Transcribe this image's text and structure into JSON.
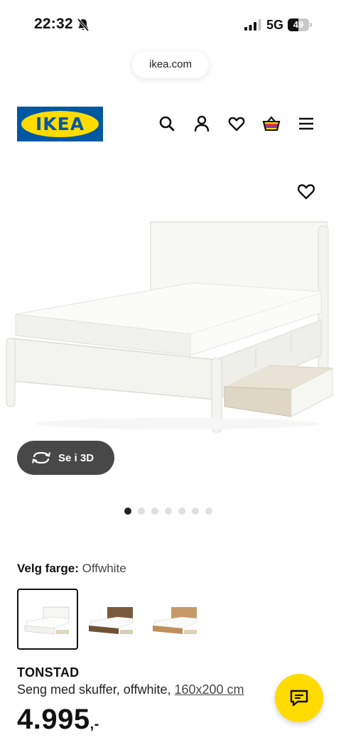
{
  "status_bar": {
    "time": "22:32",
    "network": "5G",
    "battery_percent": "49",
    "battery_level": 0.49,
    "icons": [
      "bell-slash-icon",
      "signal-icon",
      "battery-icon"
    ]
  },
  "browser": {
    "url": "ikea.com"
  },
  "header": {
    "logo_text": "IKEA",
    "brand_colors": {
      "blue": "#0058a3",
      "yellow": "#ffdb00"
    },
    "icons": [
      "search-icon",
      "user-icon",
      "heart-icon",
      "basket-icon",
      "menu-icon"
    ]
  },
  "gallery": {
    "view_3d_label": "Se i 3D",
    "image_count": 7,
    "active_index": 0
  },
  "color_selector": {
    "label": "Velg farge:",
    "selected": "Offwhite",
    "swatch_colors": [
      "#f4f3ef",
      "#7a5a3c",
      "#c69a66"
    ]
  },
  "product": {
    "name": "TONSTAD",
    "description": "Seng med skuffer, offwhite, ",
    "size": "160x200 cm",
    "price": "4.995",
    "price_suffix": ",-"
  },
  "chat": {
    "icon": "chat-icon",
    "color": "#ffdb00"
  }
}
